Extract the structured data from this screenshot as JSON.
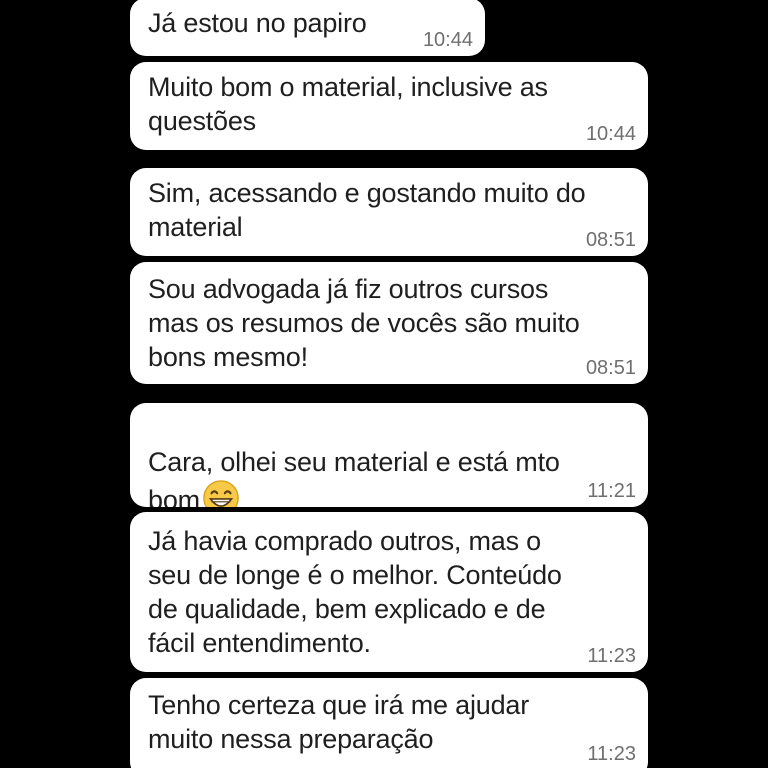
{
  "group_top": {
    "messages": [
      {
        "text": "Já estou no papiro",
        "time": "10:44"
      },
      {
        "text": "Muito bom o material, inclusive as\nquestões",
        "time": "10:44"
      },
      {
        "text": "Sim, acessando e gostando muito do\nmaterial",
        "time": "08:51"
      },
      {
        "text": "Sou advogada já fiz outros cursos\nmas os resumos de vocês são muito\nbons mesmo!",
        "time": "08:51"
      }
    ]
  },
  "group_bottom": {
    "messages": [
      {
        "text": "Cara, olhei seu material e está mto\nbom",
        "emoji": "grinning-face-emoji",
        "time": "11:21"
      },
      {
        "text": "Já havia comprado outros, mas o\nseu de longe é o melhor. Conteúdo\nde qualidade, bem explicado e de\nfácil entendimento.",
        "time": "11:23"
      },
      {
        "text": "Tenho certeza que irá me ajudar\nmuito nessa preparação",
        "time": "11:23"
      }
    ]
  },
  "colors": {
    "background": "#000000",
    "bubble": "#ffffff",
    "text": "#1f1f1f",
    "timestamp": "#6f6f6f",
    "emoji": "#f7c948"
  }
}
